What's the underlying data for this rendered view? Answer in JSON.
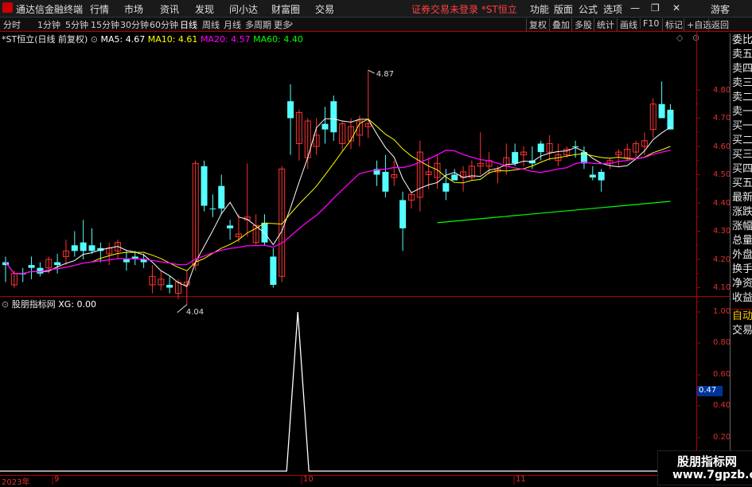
{
  "menubar": {
    "app_title": "通达信金融终端",
    "menus": [
      "行情",
      "市场",
      "资讯",
      "发现",
      "问小达",
      "财富圈",
      "交易"
    ],
    "warning": "证券交易未登录 *ST恒立",
    "right_menus": [
      "功能",
      "版面",
      "公式",
      "选项"
    ],
    "guest": "游客"
  },
  "toolbar": {
    "periods": [
      "分时",
      "1分钟",
      "5分钟",
      "15分钟",
      "30分钟",
      "60分钟",
      "日线",
      "周线",
      "月线",
      "多周期",
      "更多"
    ],
    "active_period": "日线",
    "right_buttons": [
      "复权",
      "叠加",
      "多股",
      "统计",
      "画线",
      "F10",
      "标记",
      "+自选",
      "返回"
    ]
  },
  "main_chart": {
    "stock_label": "*ST恒立(日线 前复权)",
    "ma5_label": "MA5: 4.67",
    "ma10_label": "MA10: 4.61",
    "ma20_label": "MA20: 4.57",
    "ma60_label": "MA60: 4.40",
    "high_marker": "4.87",
    "low_marker": "4.04",
    "y_ticks": [
      "4.80",
      "4.70",
      "4.60",
      "4.50",
      "4.40",
      "4.30",
      "4.20",
      "4.10"
    ]
  },
  "indicator": {
    "name": "股朋指标网",
    "xg_label": "XG: 0.00",
    "y_ticks": [
      "1.00",
      "0.80",
      "0.60",
      "0.40",
      "0.20"
    ],
    "cursor_value": "0.47"
  },
  "right_panel": [
    "委比",
    "卖五",
    "卖四",
    "卖三",
    "卖二",
    "卖一",
    "买一",
    "买二",
    "买三",
    "买四",
    "买五",
    "最新",
    "涨跌",
    "涨幅",
    "总量",
    "外盘",
    "换手",
    "净资",
    "收益",
    "自动",
    "交易"
  ],
  "date_axis": [
    "2023年",
    "9",
    "10",
    "11"
  ],
  "watermark": {
    "line1": "股朋指标网",
    "line2": "www.7gpzb.com"
  },
  "colors": {
    "up": "#ff3232",
    "down": "#54ffff",
    "ma5": "#ffffff",
    "ma10": "#ffff00",
    "ma20": "#ff00ff",
    "ma60": "#00ff00"
  },
  "chart_data": {
    "type": "candlestick",
    "candles": [
      [
        4.18,
        4.21,
        4.12,
        4.19,
        "d"
      ],
      [
        4.15,
        4.16,
        4.1,
        4.11,
        "u"
      ],
      [
        4.15,
        4.17,
        4.12,
        4.15,
        "d"
      ],
      [
        4.17,
        4.21,
        4.13,
        4.18,
        "d"
      ],
      [
        4.17,
        4.19,
        4.14,
        4.15,
        "d"
      ],
      [
        4.17,
        4.21,
        4.15,
        4.2,
        "u"
      ],
      [
        4.18,
        4.22,
        4.15,
        4.19,
        "d"
      ],
      [
        4.23,
        4.27,
        4.18,
        4.21,
        "u"
      ],
      [
        4.25,
        4.3,
        4.21,
        4.23,
        "d"
      ],
      [
        4.23,
        4.34,
        4.2,
        4.26,
        "d"
      ],
      [
        4.25,
        4.31,
        4.22,
        4.23,
        "d"
      ],
      [
        4.23,
        4.26,
        4.19,
        4.24,
        "d"
      ],
      [
        4.22,
        4.26,
        4.18,
        4.24,
        "u"
      ],
      [
        4.23,
        4.27,
        4.2,
        4.26,
        "u"
      ],
      [
        4.2,
        4.23,
        4.16,
        4.19,
        "d"
      ],
      [
        4.21,
        4.23,
        4.18,
        4.2,
        "d"
      ],
      [
        4.2,
        4.22,
        4.17,
        4.19,
        "d"
      ],
      [
        4.14,
        4.18,
        4.08,
        4.11,
        "u"
      ],
      [
        4.13,
        4.16,
        4.09,
        4.11,
        "u"
      ],
      [
        4.11,
        4.14,
        4.08,
        4.1,
        "d"
      ],
      [
        4.12,
        4.13,
        4.06,
        4.08,
        "u"
      ],
      [
        4.11,
        4.16,
        4.04,
        4.12,
        "u"
      ],
      [
        4.18,
        4.55,
        4.16,
        4.54,
        "u"
      ],
      [
        4.53,
        4.55,
        4.37,
        4.39,
        "d"
      ],
      [
        4.38,
        4.43,
        4.35,
        4.38,
        "d"
      ],
      [
        4.46,
        4.5,
        4.36,
        4.38,
        "d"
      ],
      [
        4.31,
        4.34,
        4.27,
        4.32,
        "d"
      ],
      [
        4.29,
        4.36,
        4.26,
        4.28,
        "u"
      ],
      [
        4.34,
        4.54,
        4.28,
        4.35,
        "u"
      ],
      [
        4.32,
        4.36,
        4.25,
        4.26,
        "u"
      ],
      [
        4.33,
        4.36,
        4.25,
        4.26,
        "d"
      ],
      [
        4.21,
        4.24,
        4.1,
        4.11,
        "d"
      ],
      [
        4.14,
        4.53,
        4.12,
        4.52,
        "u"
      ],
      [
        4.7,
        4.82,
        4.57,
        4.76,
        "d"
      ],
      [
        4.61,
        4.73,
        4.55,
        4.72,
        "u"
      ],
      [
        4.56,
        4.7,
        4.52,
        4.69,
        "u"
      ],
      [
        4.6,
        4.7,
        4.57,
        4.64,
        "u"
      ],
      [
        4.66,
        4.74,
        4.61,
        4.68,
        "d"
      ],
      [
        4.65,
        4.78,
        4.62,
        4.76,
        "d"
      ],
      [
        4.61,
        4.69,
        4.58,
        4.68,
        "u"
      ],
      [
        4.62,
        4.7,
        4.59,
        4.67,
        "u"
      ],
      [
        4.64,
        4.71,
        4.6,
        4.69,
        "u"
      ],
      [
        4.67,
        4.87,
        4.63,
        4.68,
        "u"
      ],
      [
        4.52,
        4.55,
        4.46,
        4.5,
        "d"
      ],
      [
        4.51,
        4.57,
        4.42,
        4.44,
        "d"
      ],
      [
        4.49,
        4.55,
        4.46,
        4.5,
        "u"
      ],
      [
        4.41,
        4.44,
        4.23,
        4.31,
        "d"
      ],
      [
        4.41,
        4.44,
        4.38,
        4.43,
        "u"
      ],
      [
        4.42,
        4.62,
        4.37,
        4.58,
        "u"
      ],
      [
        4.51,
        4.56,
        4.45,
        4.5,
        "u"
      ],
      [
        4.49,
        4.57,
        4.45,
        4.54,
        "u"
      ],
      [
        4.47,
        4.52,
        4.41,
        4.44,
        "d"
      ],
      [
        4.5,
        4.52,
        4.48,
        4.48,
        "d"
      ],
      [
        4.51,
        4.53,
        4.44,
        4.49,
        "u"
      ],
      [
        4.49,
        4.55,
        4.48,
        4.53,
        "u"
      ],
      [
        4.54,
        4.65,
        4.5,
        4.53,
        "u"
      ],
      [
        4.53,
        4.58,
        4.5,
        4.55,
        "u"
      ],
      [
        4.52,
        4.53,
        4.47,
        4.51,
        "u"
      ],
      [
        4.53,
        4.61,
        4.5,
        4.56,
        "u"
      ],
      [
        4.58,
        4.61,
        4.53,
        4.54,
        "d"
      ],
      [
        4.57,
        4.6,
        4.53,
        4.58,
        "u"
      ],
      [
        4.55,
        4.6,
        4.52,
        4.54,
        "d"
      ],
      [
        4.58,
        4.62,
        4.55,
        4.61,
        "d"
      ],
      [
        4.58,
        4.64,
        4.55,
        4.61,
        "u"
      ],
      [
        4.55,
        4.61,
        4.53,
        4.57,
        "u"
      ],
      [
        4.57,
        4.6,
        4.56,
        4.59,
        "u"
      ],
      [
        4.6,
        4.62,
        4.56,
        4.6,
        "d"
      ],
      [
        4.58,
        4.6,
        4.52,
        4.54,
        "d"
      ],
      [
        4.5,
        4.53,
        4.48,
        4.49,
        "d"
      ],
      [
        4.51,
        4.52,
        4.44,
        4.48,
        "d"
      ],
      [
        4.54,
        4.56,
        4.52,
        4.55,
        "u"
      ],
      [
        4.57,
        4.59,
        4.53,
        4.58,
        "u"
      ],
      [
        4.59,
        4.61,
        4.55,
        4.56,
        "u"
      ],
      [
        4.58,
        4.62,
        4.55,
        4.61,
        "u"
      ],
      [
        4.6,
        4.65,
        4.57,
        4.62,
        "u"
      ],
      [
        4.66,
        4.77,
        4.63,
        4.75,
        "u"
      ],
      [
        4.75,
        4.83,
        4.7,
        4.7,
        "d"
      ],
      [
        4.73,
        4.75,
        4.66,
        4.66,
        "d"
      ]
    ],
    "ma60_start_index": 50,
    "xg_spike_index": 32
  }
}
